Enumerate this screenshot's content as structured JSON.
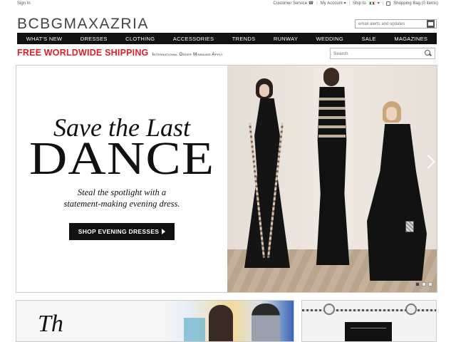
{
  "utility": {
    "sign_in": "Sign In",
    "customer_service": "Customer Service ☎",
    "my_account": "My Account ▾",
    "ship_to": "Ship to",
    "shipping_bag": "Shopping Bag (0 items)"
  },
  "brand": {
    "logo": "BCBGMAXAZRIA"
  },
  "email_signup": {
    "placeholder": "email alerts and updates"
  },
  "nav": {
    "items": [
      "WHAT'S NEW",
      "DRESSES",
      "CLOTHING",
      "ACCESSORIES",
      "TRENDS",
      "RUNWAY",
      "WEDDING",
      "SALE",
      "MAGAZINES"
    ]
  },
  "promo": {
    "headline": "FREE WORLDWIDE SHIPPING",
    "subtext": "International Order Minimums Apply"
  },
  "search": {
    "placeholder": "Search"
  },
  "hero": {
    "line1": "Save the Last",
    "line2": "DANCE",
    "subline1": "Steal the spotlight with a",
    "subline2": "statement-making evening dress.",
    "cta": "SHOP EVENING DRESSES",
    "slide_count": 3,
    "active_slide": 1
  },
  "tiles": {
    "tile1_text": "Th"
  },
  "colors": {
    "accent_red": "#d8222a",
    "nav_bg": "#111111",
    "button_bg": "#111111"
  }
}
